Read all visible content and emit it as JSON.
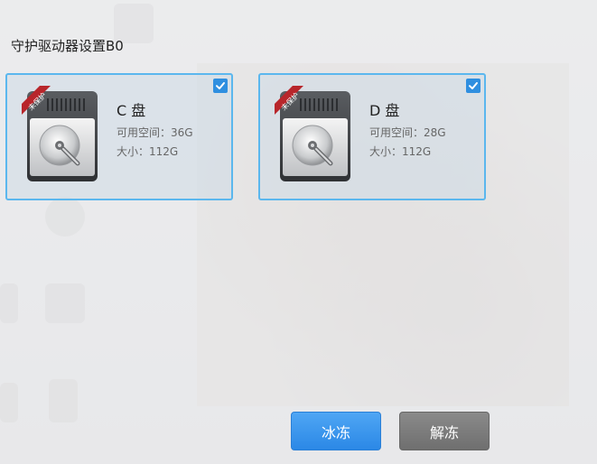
{
  "dialog": {
    "title": "守护驱动器设置B0"
  },
  "drives": [
    {
      "name": "C 盘",
      "free": "可用空间：36G",
      "size": "大小：112G",
      "badge": "未保护",
      "checked": true,
      "icon": "hard-drive-icon"
    },
    {
      "name": "D 盘",
      "free": "可用空间：28G",
      "size": "大小：112G",
      "badge": "未保护",
      "checked": true,
      "icon": "hard-drive-icon"
    }
  ],
  "actions": {
    "freeze_label": "冰冻",
    "unfreeze_label": "解冻"
  },
  "colors": {
    "card_border": "#5bb7ee",
    "checkbox": "#2f8fe0",
    "freeze_button": "#2b88e6",
    "unfreeze_button": "#777777",
    "badge": "#b8262b"
  }
}
